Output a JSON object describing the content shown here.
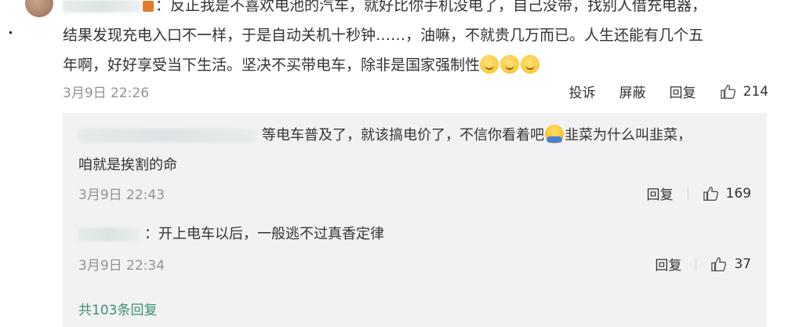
{
  "main_comment": {
    "text_line1_tail": "：反正我是不喜欢电池的汽车，就好比你手机没电了，自己没带，找别人借充电器，",
    "text_line2": "结果发现充电入口不一样，于是自动关机十秒钟……，油嘛，不就贵几万而已。人生还能有几个五",
    "text_line3": "年啊，好好享受当下生活。坚决不买带电车，除非是国家强制性",
    "time": "3月9日 22:26",
    "report_label": "投诉",
    "block_label": "屏蔽",
    "reply_label": "回复",
    "like_count": "214"
  },
  "replies": [
    {
      "text_part1": "等电车普及了，就该搞电价了，不信你看着吧",
      "text_part2": "韭菜为什么叫韭菜，",
      "text_line2": "咱就是挨割的命",
      "time": "3月9日 22:43",
      "reply_label": "回复",
      "like_count": "169"
    },
    {
      "text": "：开上电车以后，一般逃不过真香定律",
      "time": "3月9日 22:34",
      "reply_label": "回复",
      "like_count": "37"
    }
  ],
  "more_replies_label": "共103条回复",
  "colors": {
    "reply_bg": "#f2f2f5",
    "meta_gray": "#939393",
    "link_green": "#3f8f6f"
  }
}
